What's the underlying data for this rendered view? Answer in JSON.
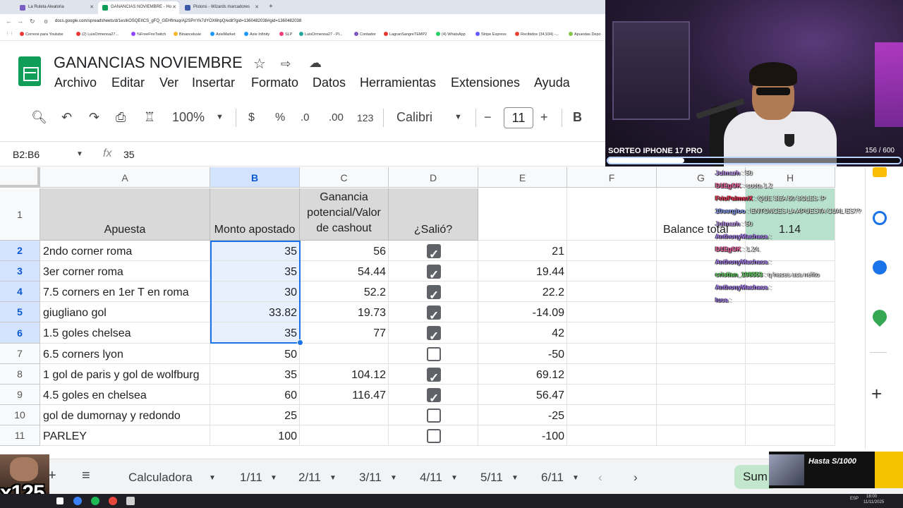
{
  "browser": {
    "tabs": [
      {
        "label": "La Ruleta Aleatoria",
        "color": "#7b5cc5"
      },
      {
        "label": "GANANCIAS NOVIEMBRE - Ho",
        "color": "#0f9d58"
      },
      {
        "label": "Pistons - Wizards marcadores",
        "color": "#3b5ba9"
      }
    ],
    "url": "docs.google.com/spreadsheets/d/1esIkOSQEIICS_gFQ_GEHfmuqrAj2SPrrYk7dYOX6hpQ/edit?gid=1360482038#gid=1360482038",
    "bookmarks": [
      "Correos para Youtube",
      "(2) LuisOrmenoa27...",
      "%FreeFireTwitch",
      "Binancelusie",
      "AxieMarket",
      "Axie Infinity",
      "SLP",
      "LuisOrmenoa27 - Pl...",
      "Contador",
      "LagranSangreTEMP2",
      "(4) WhatsApp",
      "Stripe Express",
      "Recibidos (34,934) -...",
      "Apuestas Depo"
    ]
  },
  "sheets": {
    "title": "GANANCIAS NOVIEMBRE",
    "menu": [
      "Archivo",
      "Editar",
      "Ver",
      "Insertar",
      "Formato",
      "Datos",
      "Herramientas",
      "Extensiones",
      "Ayuda"
    ],
    "toolbar": {
      "zoom": "100%",
      "currency": "$",
      "percent": "%",
      "dec_less": ".0",
      "dec_more": ".00",
      "format_123": "123",
      "font": "Calibri",
      "font_size": "11",
      "bold": "B"
    },
    "namebox": "B2:B6",
    "formula": "35",
    "columns": [
      "A",
      "B",
      "C",
      "D",
      "E",
      "F",
      "G",
      "H"
    ],
    "rows": [
      "1",
      "2",
      "3",
      "4",
      "5",
      "6",
      "7",
      "8",
      "9",
      "10",
      "11"
    ],
    "header": {
      "apuesta": "Apuesta",
      "monto": "Monto apostado",
      "ganancia": "Ganancia potencial/Valor de cashout",
      "salio": "¿Salió?"
    },
    "balance_label": "Balance total",
    "balance_value": "1.14",
    "data": [
      {
        "apuesta": "2ndo corner roma",
        "monto": "35",
        "ganancia": "56",
        "salio": true,
        "balance": "21"
      },
      {
        "apuesta": "3er corner roma",
        "monto": "35",
        "ganancia": "54.44",
        "salio": true,
        "balance": "19.44"
      },
      {
        "apuesta": "7.5 corners en 1er T en roma",
        "monto": "30",
        "ganancia": "52.2",
        "salio": true,
        "balance": "22.2"
      },
      {
        "apuesta": "giugliano gol",
        "monto": "33.82",
        "ganancia": "19.73",
        "salio": true,
        "balance": "-14.09"
      },
      {
        "apuesta": "1.5 goles chelsea",
        "monto": "35",
        "ganancia": "77",
        "salio": true,
        "balance": "42"
      },
      {
        "apuesta": "6.5 corners lyon",
        "monto": "50",
        "ganancia": "",
        "salio": false,
        "balance": "-50"
      },
      {
        "apuesta": "1 gol de paris y gol de wolfburg",
        "monto": "35",
        "ganancia": "104.12",
        "salio": true,
        "balance": "69.12"
      },
      {
        "apuesta": "4.5 goles en chelsea",
        "monto": "60",
        "ganancia": "116.47",
        "salio": true,
        "balance": "56.47"
      },
      {
        "apuesta": "gol de dumornay y redondo",
        "monto": "25",
        "ganancia": "",
        "salio": false,
        "balance": "-25"
      },
      {
        "apuesta": "PARLEY",
        "monto": "100",
        "ganancia": "",
        "salio": false,
        "balance": "-100"
      }
    ],
    "sheet_tabs": [
      "Calculadora",
      "1/11",
      "2/11",
      "3/11",
      "4/11",
      "5/11",
      "6/11"
    ],
    "sum_label": "Sum"
  },
  "stream": {
    "raffle_title": "SORTEO IPHONE 17 PRO",
    "raffle_count": "156  / 600",
    "raffle_progress": 0.26,
    "chat": [
      {
        "user": "Julmarh",
        "msg": ": 50",
        "color": "#c9a0ff"
      },
      {
        "user": "D1EgOK",
        "msg": ": cuota 1.2",
        "color": "#ff66aa"
      },
      {
        "user": "FrioPalmerX",
        "msg": ": QUE SEA 50 SOLES :P",
        "color": "#ff3355"
      },
      {
        "user": "10sergioo",
        "msg": ": ENTONCES LA APUESTA CUAL ES??",
        "color": "#8aa0ff"
      },
      {
        "user": "Julmarh",
        "msg": ": 50",
        "color": "#c9a0ff"
      },
      {
        "user": "AnthonyMachaca",
        "msg": ":",
        "color": "#b388ff"
      },
      {
        "user": "D1EgOK",
        "msg": ": 1.24.",
        "color": "#ff66aa"
      },
      {
        "user": "AnthonyMachaca",
        "msg": ":",
        "color": "#b388ff"
      },
      {
        "user": "cristian_198553",
        "msg": ": q haces aca nefito",
        "color": "#66dd66"
      },
      {
        "user": "AnthonyMachaca",
        "msg": ":",
        "color": "#b388ff"
      },
      {
        "user": "luca",
        "msg": ":",
        "color": "#b388ff"
      }
    ],
    "promo": "Hasta S/1000",
    "multiplier": "x125"
  },
  "taskbar": {
    "lang": "ESP",
    "time": "18:00",
    "date": "11/11/2025"
  }
}
